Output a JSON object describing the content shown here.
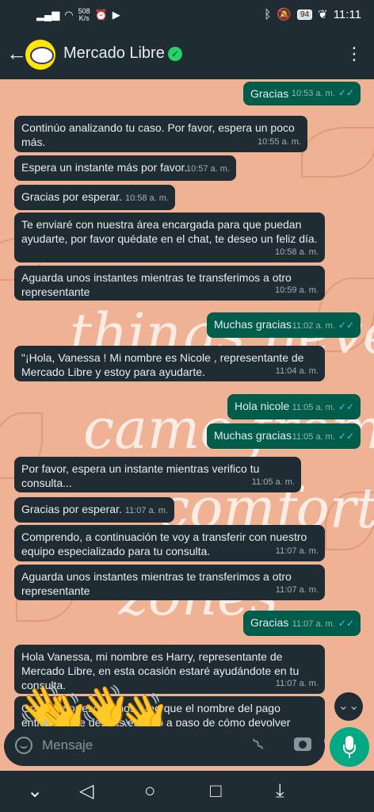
{
  "status": {
    "net_speed_value": "508",
    "net_speed_unit": "K/s",
    "battery": "94",
    "time": "11:11"
  },
  "header": {
    "back_icon": "←",
    "title": "Mercado Libre",
    "verified_icon": "✓",
    "menu_icon": "⋮"
  },
  "messages": [
    {
      "dir": "out",
      "text": "Gracias",
      "time": "10:53 a. m."
    },
    {
      "dir": "in",
      "text": "Continúo analizando tu caso. Por favor, espera un poco más.",
      "time": "10:55 a. m."
    },
    {
      "dir": "in",
      "text": "Espera un instante más por favor.",
      "time": "10:57 a. m."
    },
    {
      "dir": "in",
      "text": "Gracias por esperar.",
      "time": "10:58 a. m."
    },
    {
      "dir": "in",
      "text": "Te enviaré con nuestra área encargada para que puedan ayudarte, por favor quédate en el chat, te deseo un feliz día.",
      "time": "10:58 a. m."
    },
    {
      "dir": "in",
      "text": "Aguarda unos instantes mientras te transferimos a otro representante",
      "time": "10:59 a. m."
    },
    {
      "dir": "out",
      "text": "Muchas gracias",
      "time": "11:02 a. m."
    },
    {
      "dir": "in",
      "text": "\"¡Hola, Vanessa  ! Mi nombre es   Nicole , representante de Mercado Libre y estoy para ayudarte.",
      "time": "11:04 a. m."
    },
    {
      "dir": "out",
      "text": "Hola nicole",
      "time": "11:05 a. m."
    },
    {
      "dir": "out",
      "text": "Muchas gracias",
      "time": "11:05 a. m."
    },
    {
      "dir": "in",
      "text": "Por favor, espera un instante mientras verifico tu consulta...",
      "time": "11:05 a. m."
    },
    {
      "dir": "in",
      "text": "Gracias por esperar.",
      "time": "11:07 a. m."
    },
    {
      "dir": "in",
      "text": "Comprendo, a continuación te voy a transferir con nuestro equipo especializado para tu consulta.",
      "time": "11:07 a. m."
    },
    {
      "dir": "in",
      "text": "Aguarda unos instantes mientras te transferimos a otro representante",
      "time": "11:07 a. m."
    },
    {
      "dir": "out",
      "text": "Gracias",
      "time": "11:07 a. m."
    },
    {
      "dir": "in",
      "text": "Hola Vanessa, mi nombre es Harry, representante de Mercado Libre, en esta ocasión estaré ayudándote en tu consulta.",
      "time": "11:07 a. m."
    },
    {
      "dir": "in",
      "text": "Gracias por escribirnos. Veo que el nombre del pago entiendo que deseas el paso a paso de cómo devolver dinero en Mercado Libre\" ¿correcto?",
      "time": ""
    }
  ],
  "ticks": "✓✓",
  "watermark": [
    "things never",
    "came from",
    "comfort",
    "zones"
  ],
  "input": {
    "placeholder": "Mensaje"
  },
  "scroll_icon": "⌄⌄",
  "hands_emoji": "👋",
  "nav": {
    "down": "⌄",
    "back": "◁",
    "home": "○",
    "recents": "□",
    "drawer": "⤓"
  },
  "colors": {
    "accent": "#00a884",
    "outgoing": "#005c4b",
    "incoming": "#1f2c34",
    "wallpaper": "#f0b294"
  }
}
